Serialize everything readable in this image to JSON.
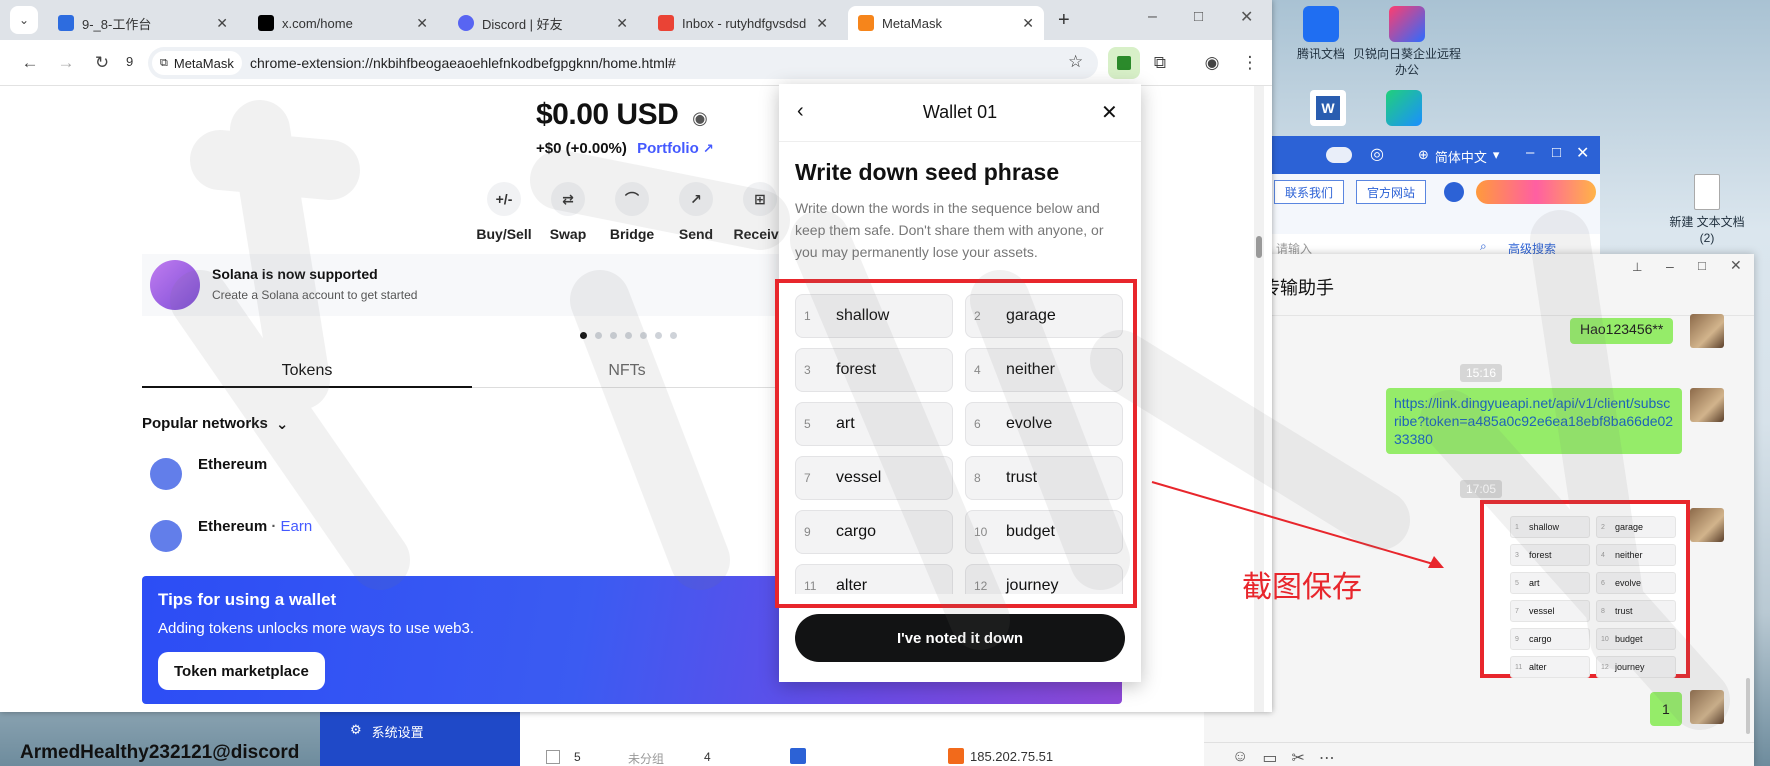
{
  "browser": {
    "tabs": [
      {
        "label": "9-_8-工作台",
        "active": false
      },
      {
        "label": "x.com/home",
        "active": false
      },
      {
        "label": "Discord | 好友",
        "active": false
      },
      {
        "label": "Inbox - rutyhdfgvsdsdgd",
        "active": false
      },
      {
        "label": "MetaMask",
        "active": true
      }
    ],
    "reload_badge": "9",
    "site_chip": "MetaMask",
    "url": "chrome-extension://nkbihfbeogaeaoehlefnkodbefgpgknn/home.html#"
  },
  "wallet": {
    "balance": "$0.00 USD",
    "change": "+$0 (+0.00%)",
    "portfolio_label": "Portfolio",
    "actions": [
      {
        "label": "Buy/Sell",
        "icon": "+/-"
      },
      {
        "label": "Swap",
        "icon": "⇄"
      },
      {
        "label": "Bridge",
        "icon": "⌒"
      },
      {
        "label": "Send",
        "icon": "↗"
      },
      {
        "label": "Receive",
        "icon": "⊞"
      }
    ],
    "banner_title": "Solana is now supported",
    "banner_sub": "Create a Solana account to get started",
    "tab_tokens": "Tokens",
    "tab_nfts": "NFTs",
    "popular_networks": "Popular networks",
    "networks": [
      {
        "name": "Ethereum",
        "extra": ""
      },
      {
        "name": "Ethereum",
        "extra": "Earn"
      }
    ],
    "tips_title": "Tips for using a wallet",
    "tips_text": "Adding tokens unlocks more ways to use web3.",
    "tips_button": "Token marketplace"
  },
  "seed_popup": {
    "title": "Wallet 01",
    "heading": "Write down seed phrase",
    "description": "Write down the words in the sequence below and keep them safe. Don't share them with anyone, or you may permanently lose your assets.",
    "words": [
      {
        "n": "1",
        "w": "shallow"
      },
      {
        "n": "2",
        "w": "garage"
      },
      {
        "n": "3",
        "w": "forest"
      },
      {
        "n": "4",
        "w": "neither"
      },
      {
        "n": "5",
        "w": "art"
      },
      {
        "n": "6",
        "w": "evolve"
      },
      {
        "n": "7",
        "w": "vessel"
      },
      {
        "n": "8",
        "w": "trust"
      },
      {
        "n": "9",
        "w": "cargo"
      },
      {
        "n": "10",
        "w": "budget"
      },
      {
        "n": "11",
        "w": "alter"
      },
      {
        "n": "12",
        "w": "journey"
      }
    ],
    "confirm_button": "I've noted it down"
  },
  "annotation": {
    "text": "截图保存",
    "color": "#e8262c"
  },
  "desktop": {
    "icons": [
      "腾讯文档",
      "贝锐向日葵企业远程办公",
      "新建 文本文档 (2)"
    ]
  },
  "qq_window": {
    "lang": "简体中文",
    "btn_contact": "联系我们",
    "btn_site": "官方网站",
    "search_placeholder": "请输入",
    "advanced": "高级搜索"
  },
  "wechat": {
    "title": "文件传输助手",
    "msg_top": "Hao123456**",
    "time1": "15:16",
    "msg_link": "https://link.dingyueapi.net/api/v1/client/subscribe?token=a485a0c92e6ea18ebf8ba66de0233380",
    "time2": "17:05",
    "msg_last": "1"
  },
  "background_app": {
    "menu_item": "系统设置",
    "row_index": "5",
    "row_group": "未分组",
    "row_count": "4",
    "row_ip": "185.202.75.51"
  },
  "bottom_text": "ArmedHealthy232121@discord"
}
